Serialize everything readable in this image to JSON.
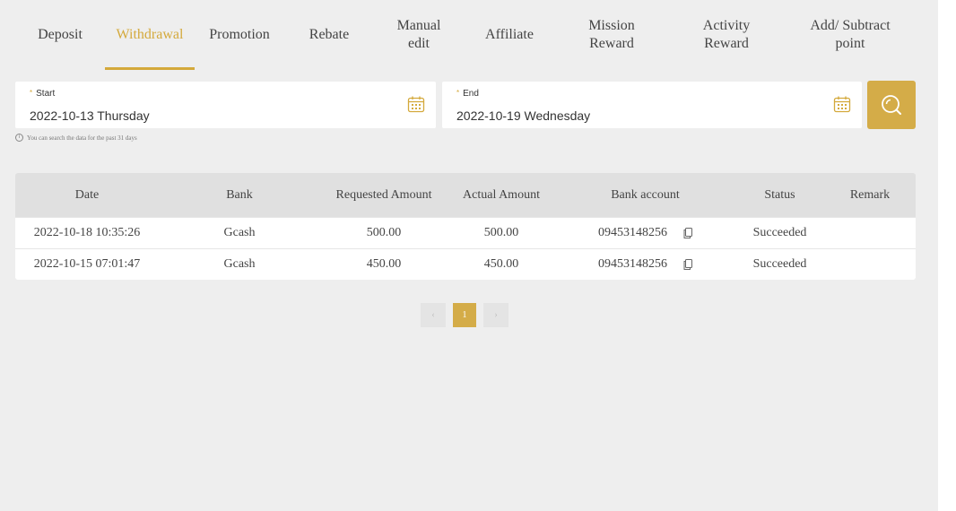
{
  "tabs": [
    {
      "label": "Deposit",
      "active": false
    },
    {
      "label": "Withdrawal",
      "active": true
    },
    {
      "label": "Promotion",
      "active": false
    },
    {
      "label": "Rebate",
      "active": false
    },
    {
      "label": "Manual\nedit",
      "active": false
    },
    {
      "label": "Affiliate",
      "active": false
    },
    {
      "label": "Mission\nReward",
      "active": false
    },
    {
      "label": "Activity\nReward",
      "active": false
    },
    {
      "label": "Add/ Subtract\npoint",
      "active": false
    }
  ],
  "filters": {
    "start": {
      "label": "Start",
      "value": "2022-10-13 Thursday"
    },
    "end": {
      "label": "End",
      "value": "2022-10-19 Wednesday"
    },
    "hint": "You can search the data for the past 31 days",
    "required_mark": "*"
  },
  "table": {
    "headers": {
      "date": "Date",
      "bank": "Bank",
      "requested": "Requested Amount",
      "actual": "Actual Amount",
      "account": "Bank account",
      "status": "Status",
      "remark": "Remark"
    },
    "rows": [
      {
        "date": "2022-10-18 10:35:26",
        "bank": "Gcash",
        "requested": "500.00",
        "actual": "500.00",
        "account": "09453148256",
        "status": "Succeeded",
        "remark": ""
      },
      {
        "date": "2022-10-15 07:01:47",
        "bank": "Gcash",
        "requested": "450.00",
        "actual": "450.00",
        "account": "09453148256",
        "status": "Succeeded",
        "remark": ""
      }
    ]
  },
  "pagination": {
    "prev": "‹",
    "current": "1",
    "next": "›"
  },
  "colors": {
    "accent": "#d4a93b",
    "search_button": "#d4ac48",
    "background": "#eeeeee",
    "header_bg": "#e0e0e0"
  },
  "icons": {
    "calendar": "calendar-icon",
    "search": "search-icon",
    "copy": "copy-icon",
    "info": "info-icon"
  }
}
